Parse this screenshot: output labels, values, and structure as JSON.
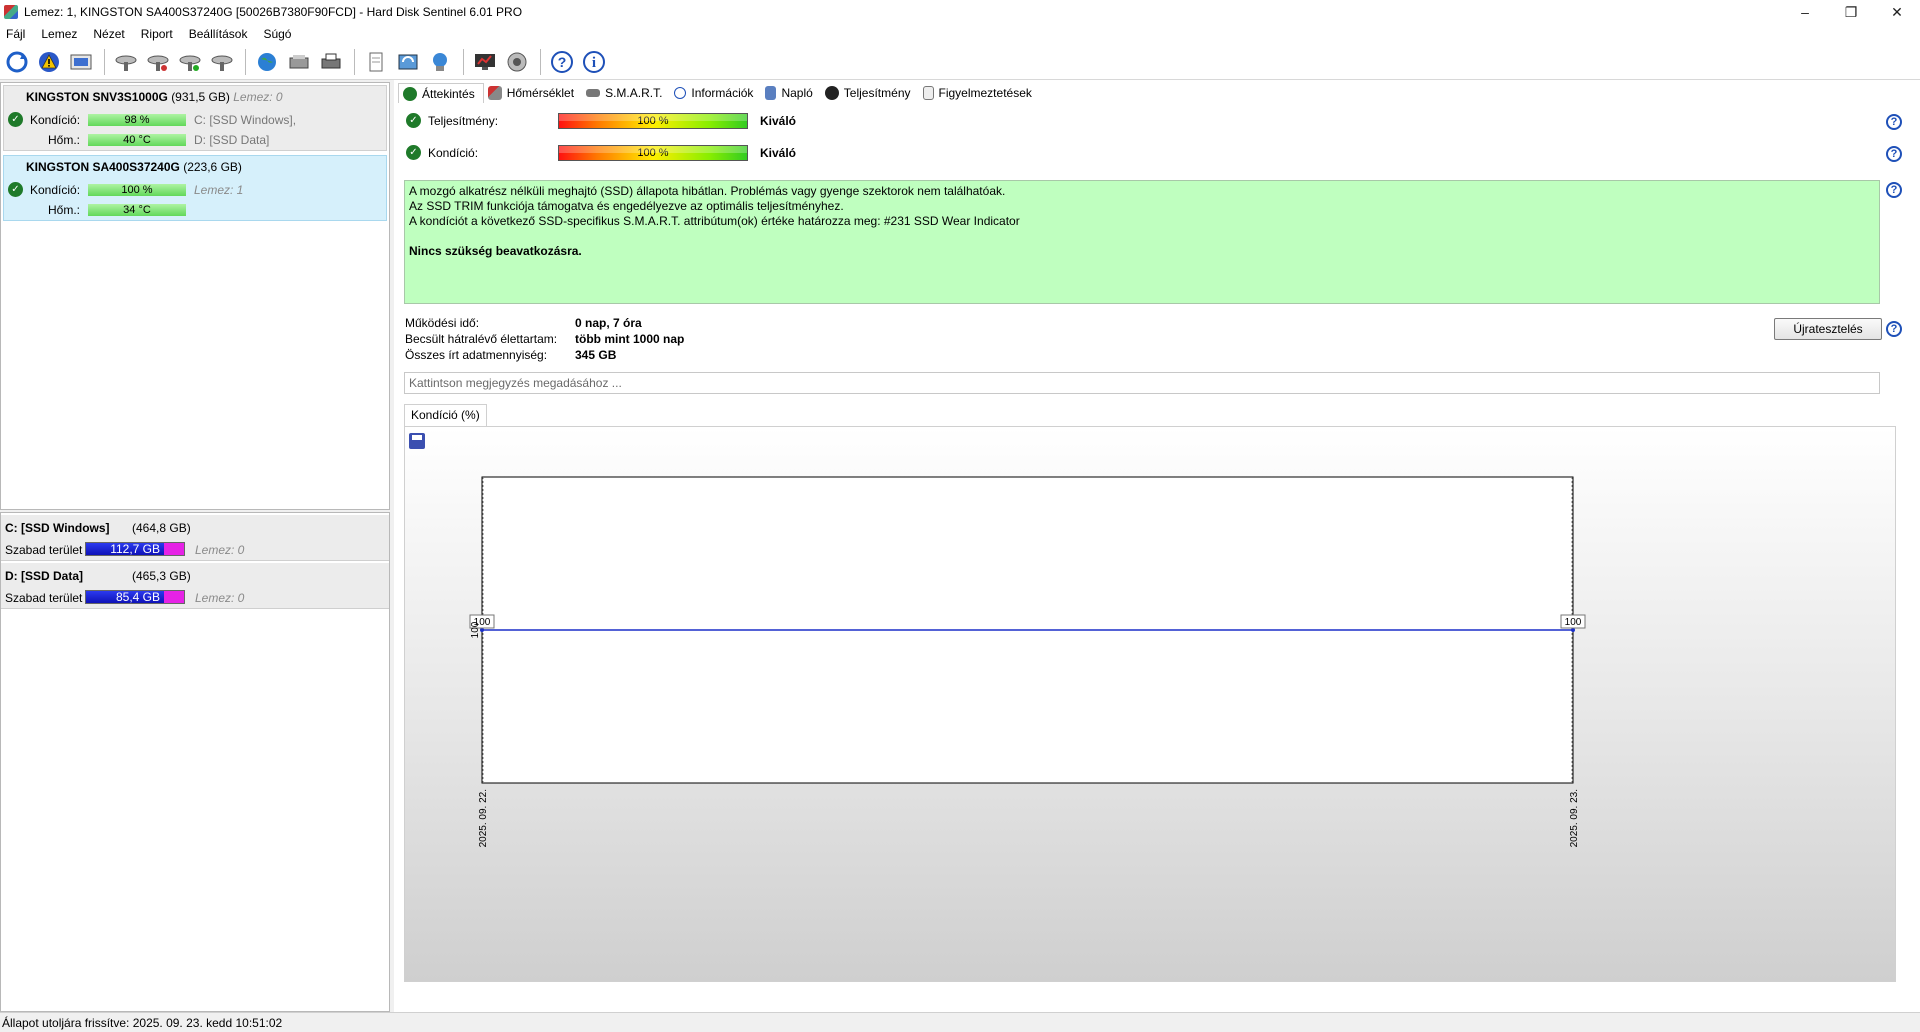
{
  "window": {
    "title": "Lemez: 1, KINGSTON SA400S37240G [50026B7380F90FCD]  -  Hard Disk Sentinel 6.01 PRO"
  },
  "menu": [
    "Fájl",
    "Lemez",
    "Nézet",
    "Riport",
    "Beállítások",
    "Súgó"
  ],
  "disks": [
    {
      "name": "KINGSTON SNV3S1000G",
      "size": "(931,5 GB)",
      "lemez": "Lemez: 0",
      "kondicio_label": "Kondíció:",
      "kondicio": "98 %",
      "hom_label": "Hőm.:",
      "hom": "40 °C",
      "vol1": "C: [SSD Windows],",
      "vol2": "D: [SSD Data]"
    },
    {
      "name": "KINGSTON SA400S37240G",
      "size": "(223,6 GB)",
      "kondicio_label": "Kondíció:",
      "kondicio": "100 %",
      "lemez": "Lemez: 1",
      "hom_label": "Hőm.:",
      "hom": "34 °C"
    }
  ],
  "volumes": [
    {
      "name": "C: [SSD Windows]",
      "size": "(464,8 GB)",
      "free_label": "Szabad terület",
      "free": "112,7 GB",
      "lemez": "Lemez: 0"
    },
    {
      "name": "D: [SSD Data]",
      "size": "(465,3 GB)",
      "free_label": "Szabad terület",
      "free": "85,4 GB",
      "lemez": "Lemez: 0"
    }
  ],
  "tabs": [
    "Áttekintés",
    "Hőmérséklet",
    "S.M.A.R.T.",
    "Információk",
    "Napló",
    "Teljesítmény",
    "Figyelmeztetések"
  ],
  "metrics": {
    "performance": {
      "label": "Teljesítmény:",
      "value": "100 %",
      "rating": "Kiváló"
    },
    "condition": {
      "label": "Kondíció:",
      "value": "100 %",
      "rating": "Kiváló"
    }
  },
  "status": {
    "line1": "A mozgó alkatrész nélküli meghajtó (SSD) állapota hibátlan. Problémás vagy gyenge szektorok nem találhatóak.",
    "line2": "Az SSD TRIM funkciója támogatva és engedélyezve az optimális teljesítményhez.",
    "line3": "A kondíciót a következő SSD-specifikus S.M.A.R.T. attribútum(ok) értéke határozza meg:  #231 SSD Wear Indicator",
    "action": "Nincs szükség beavatkozásra."
  },
  "info": {
    "uptime_label": "Működési idő:",
    "uptime": "0 nap, 7 óra",
    "lifetime_label": "Becsült hátralévő élettartam:",
    "lifetime": "több mint 1000 nap",
    "written_label": "Összes írt adatmennyiség:",
    "written": "345 GB"
  },
  "retest_button": "Újratesztelés",
  "note_placeholder": "Kattintson megjegyzés megadásához ...",
  "chart_tab": "Kondíció  (%)",
  "chart_data": {
    "type": "line",
    "x": [
      "2025. 09. 22.",
      "2025. 09. 23."
    ],
    "values": [
      100,
      100
    ],
    "point_labels": [
      "100",
      "100"
    ],
    "y_tick": "100",
    "color": "#1a2fc9"
  },
  "statusbar": "Állapot utoljára frissítve: 2025. 09. 23. kedd 10:51:02",
  "colors": {
    "ok_green": "#1f7a2a",
    "status_bg": "#bfffbf",
    "selected_bg": "#d6f0fb",
    "help_blue": "#1e50b8"
  }
}
